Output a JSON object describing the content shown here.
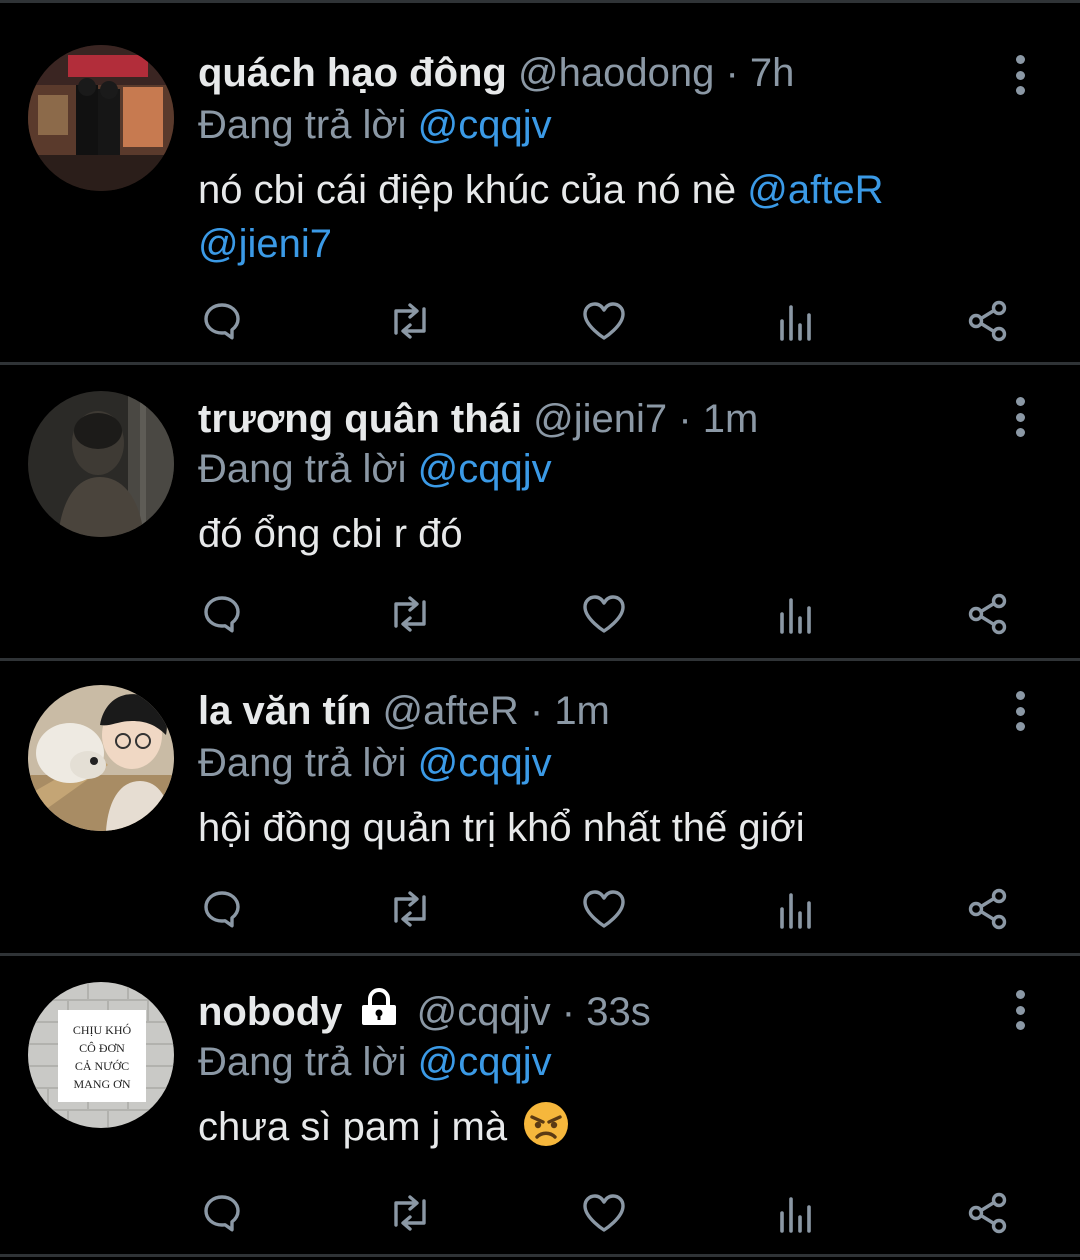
{
  "tweets": [
    {
      "name": "quách hạo đông",
      "handle": "@haodong",
      "separator": "·",
      "time": "7h",
      "reply_prefix": "Đang trả lời",
      "reply_to": "@cqqjv",
      "text": "nó cbi cái điệp khúc của nó nè",
      "mention_1": "@afteR",
      "mention_2": "@jieni7",
      "protected": false
    },
    {
      "name": "trương quân thái",
      "handle": "@jieni7",
      "separator": "·",
      "time": "1m",
      "reply_prefix": "Đang trả lời",
      "reply_to": "@cqqjv",
      "text": "đó ổng cbi r đó",
      "protected": false
    },
    {
      "name": "la văn tín",
      "handle": "@afteR",
      "separator": "·",
      "time": "1m",
      "reply_prefix": "Đang trả lời",
      "reply_to": "@cqqjv",
      "text": "hội đồng quản trị khổ nhất thế giới",
      "protected": false
    },
    {
      "name": "nobody",
      "handle": "@cqqjv",
      "separator": "·",
      "time": "33s",
      "reply_prefix": "Đang trả lời",
      "reply_to": "@cqqjv",
      "text": "chưa sì pam j mà",
      "emoji": "angry-face",
      "protected": true,
      "avatar_sign": [
        "CHỊU KHÓ",
        "CÔ ĐƠN",
        "CẢ NƯỚC",
        "MANG ƠN"
      ]
    }
  ],
  "icons": [
    "reply-icon",
    "retweet-icon",
    "like-icon",
    "views-icon",
    "share-icon",
    "more-icon",
    "lock-icon"
  ],
  "colors": {
    "background": "#000000",
    "divider": "#2f3336",
    "text": "#e7e9ea",
    "muted": "#8b98a5",
    "mention": "#3b9ae6"
  }
}
